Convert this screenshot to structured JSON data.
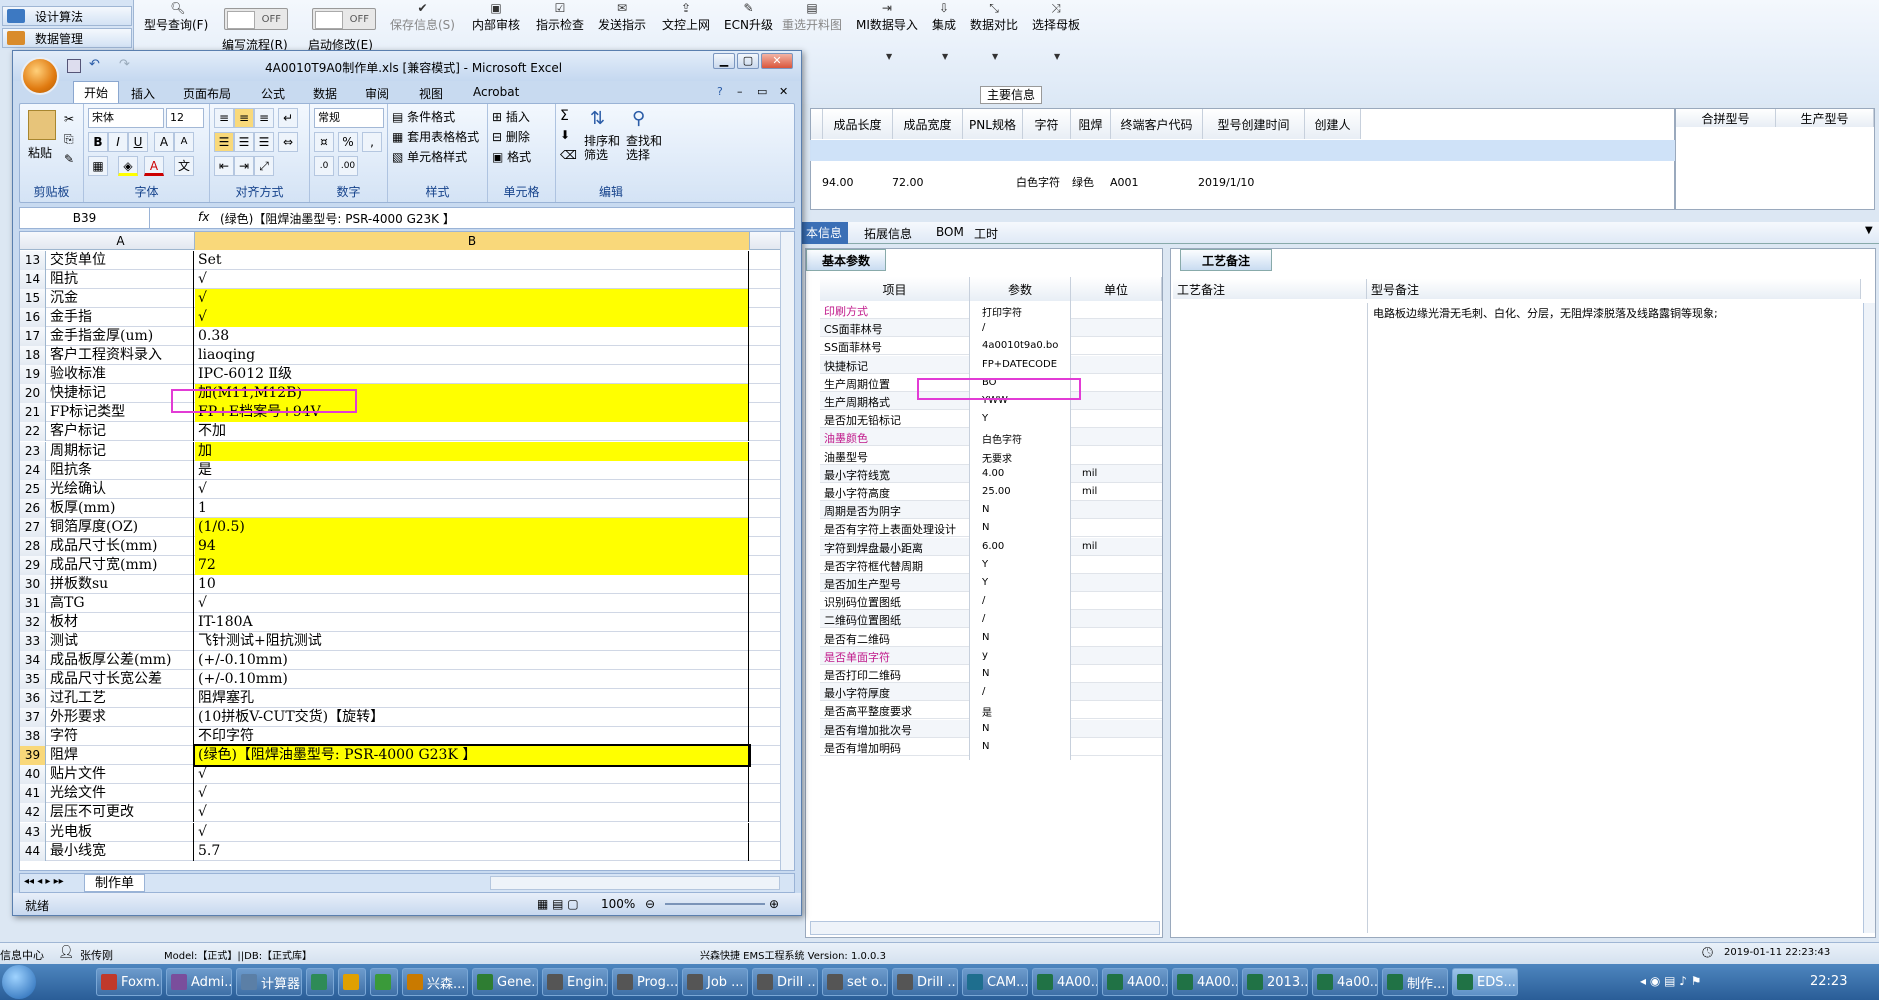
{
  "host": {
    "nav": [
      "设计算法",
      "数据管理"
    ],
    "toolbar": [
      {
        "label": "型号查询(F)",
        "icon": "search-icon"
      },
      {
        "label": "保存信息(S)",
        "icon": "check-icon"
      },
      {
        "label": "内部审核",
        "icon": "print-icon"
      },
      {
        "label": "指示检查",
        "icon": "checklist-icon"
      },
      {
        "label": "发送指示",
        "icon": "send-icon"
      },
      {
        "label": "文控上网",
        "icon": "upload-icon"
      },
      {
        "label": "ECN升级",
        "icon": "wrench-icon"
      },
      {
        "label": "重选开料图",
        "icon": "image-icon"
      },
      {
        "label": "MI数据导入",
        "icon": "import-icon"
      },
      {
        "label": "集成",
        "icon": "download-icon"
      },
      {
        "label": "数据对比",
        "icon": "compare-icon"
      },
      {
        "label": "选择母板",
        "icon": "shuffle-icon"
      }
    ],
    "toggle1": "OFF",
    "toggle2": "OFF",
    "sub1": "编写流程(R)",
    "sub2": "启动修改(E)",
    "main_header": "主要信息",
    "grid_headers": [
      "成品长度",
      "成品宽度",
      "PNL规格",
      "字符",
      "阻焊",
      "终端客户代码",
      "型号创建时间",
      "创建人"
    ],
    "grid_row": [
      "94.00",
      "72.00",
      "",
      "白色字符",
      "绿色",
      "A001",
      "2019/1/10",
      ""
    ],
    "right_headers": [
      "合拼型号",
      "生产型号"
    ],
    "lower_tabs": [
      "本信息",
      "拓展信息",
      "BOM",
      "工时"
    ],
    "bp_tab": "基本参数",
    "bp_headers": [
      "项目",
      "参数",
      "单位"
    ],
    "bp_rows": [
      {
        "k": "印刷方式",
        "v": "打印字符",
        "u": "",
        "pink": true
      },
      {
        "k": "CS面菲林号",
        "v": "/",
        "u": ""
      },
      {
        "k": "SS面菲林号",
        "v": "4a0010t9a0.bo",
        "u": ""
      },
      {
        "k": "快捷标记",
        "v": "FP+DATECODE",
        "u": ""
      },
      {
        "k": "生产周期位置",
        "v": "BO",
        "u": ""
      },
      {
        "k": "生产周期格式",
        "v": "YWW",
        "u": ""
      },
      {
        "k": "是否加无铅标记",
        "v": "Y",
        "u": ""
      },
      {
        "k": "油墨颜色",
        "v": "白色字符",
        "u": "",
        "pink": true
      },
      {
        "k": "油墨型号",
        "v": "无要求",
        "u": ""
      },
      {
        "k": "最小字符线宽",
        "v": "4.00",
        "u": "mil"
      },
      {
        "k": "最小字符高度",
        "v": "25.00",
        "u": "mil"
      },
      {
        "k": "周期是否为阴字",
        "v": "N",
        "u": ""
      },
      {
        "k": "是否有字符上表面处理设计",
        "v": "N",
        "u": ""
      },
      {
        "k": "字符到焊盘最小距离",
        "v": "6.00",
        "u": "mil"
      },
      {
        "k": "是否字符框代替周期",
        "v": "Y",
        "u": ""
      },
      {
        "k": "是否加生产型号",
        "v": "Y",
        "u": ""
      },
      {
        "k": "识别码位置图纸",
        "v": "/",
        "u": ""
      },
      {
        "k": "二维码位置图纸",
        "v": "/",
        "u": ""
      },
      {
        "k": "是否有二维码",
        "v": "N",
        "u": ""
      },
      {
        "k": "是否单面字符",
        "v": "y",
        "u": "",
        "pink": true
      },
      {
        "k": "是否打印二维码",
        "v": "N",
        "u": ""
      },
      {
        "k": "最小字符厚度",
        "v": "/",
        "u": ""
      },
      {
        "k": "是否高平整度要求",
        "v": "是",
        "u": ""
      },
      {
        "k": "是否有增加批次号",
        "v": "N",
        "u": ""
      },
      {
        "k": "是否有增加明码",
        "v": "N",
        "u": ""
      }
    ],
    "pn_tab": "工艺备注",
    "pn_headers": [
      "工艺备注",
      "型号备注"
    ],
    "pn_note": "电路板边缘光滑无毛刺、白化、分层，无阻焊漆脱落及线路露铜等现象;",
    "status_left": "信息中心",
    "status_user": "张传刚",
    "status_model": "Model:【正式】||DB:【正式库】",
    "status_version": "兴森快捷 EMS工程系统 Version: 1.0.0.3",
    "status_time": "2019-01-11 22:23:43"
  },
  "excel": {
    "title": "4A0010T9A0制作单.xls [兼容模式] - Microsoft Excel",
    "tabs": [
      "开始",
      "插入",
      "页面布局",
      "公式",
      "数据",
      "审阅",
      "视图",
      "Acrobat"
    ],
    "font_name": "宋体",
    "font_size": "12",
    "num_format": "常规",
    "groups": [
      "剪贴板",
      "字体",
      "对齐方式",
      "数字",
      "样式",
      "单元格",
      "编辑"
    ],
    "paste": "粘贴",
    "style_items": [
      "条件格式",
      "套用表格格式",
      "单元格样式"
    ],
    "cell_items": [
      "插入",
      "删除",
      "格式"
    ],
    "edit_items": [
      "排序和\n筛选",
      "查找和\n选择"
    ],
    "name_box": "B39",
    "formula": "(绿色)【阻焊油墨型号: PSR-4000 G23K 】",
    "col_a": "A",
    "col_b": "B",
    "rows": [
      {
        "n": "13",
        "a": "交货单位",
        "b": "Set",
        "y": false
      },
      {
        "n": "14",
        "a": "阻抗",
        "b": "√",
        "y": false
      },
      {
        "n": "15",
        "a": "沉金",
        "b": "√",
        "y": true
      },
      {
        "n": "16",
        "a": "金手指",
        "b": "√",
        "y": true
      },
      {
        "n": "17",
        "a": "金手指金厚(um)",
        "b": "0.38",
        "y": false
      },
      {
        "n": "18",
        "a": "客户工程资料录入",
        "b": "liaoqing",
        "y": false
      },
      {
        "n": "19",
        "a": "验收标准",
        "b": "IPC-6012 Ⅱ级",
        "y": false
      },
      {
        "n": "20",
        "a": "快捷标记",
        "b": "加(M11,M12B)",
        "y": true
      },
      {
        "n": "21",
        "a": "FP标记类型",
        "b": "FP+E档案号+94V",
        "y": true
      },
      {
        "n": "22",
        "a": "客户标记",
        "b": "不加",
        "y": false
      },
      {
        "n": "23",
        "a": "周期标记",
        "b": "加",
        "y": true
      },
      {
        "n": "24",
        "a": "阻抗条",
        "b": "是",
        "y": false
      },
      {
        "n": "25",
        "a": "光绘确认",
        "b": "√",
        "y": false
      },
      {
        "n": "26",
        "a": "板厚(mm)",
        "b": "1",
        "y": false
      },
      {
        "n": "27",
        "a": "铜箔厚度(OZ)",
        "b": "(1/0.5)",
        "y": true
      },
      {
        "n": "28",
        "a": "成品尺寸长(mm)",
        "b": "94",
        "y": true
      },
      {
        "n": "29",
        "a": "成品尺寸宽(mm)",
        "b": "72",
        "y": true
      },
      {
        "n": "30",
        "a": "拼板数su",
        "b": "10",
        "y": false
      },
      {
        "n": "31",
        "a": "高TG",
        "b": "√",
        "y": false
      },
      {
        "n": "32",
        "a": "板材",
        "b": "IT-180A",
        "y": false
      },
      {
        "n": "33",
        "a": "测试",
        "b": "飞针测试+阻抗测试",
        "y": false
      },
      {
        "n": "34",
        "a": "成品板厚公差(mm)",
        "b": "(+/-0.10mm)",
        "y": false
      },
      {
        "n": "35",
        "a": "成品尺寸长宽公差",
        "b": "(+/-0.10mm)",
        "y": false
      },
      {
        "n": "36",
        "a": "过孔工艺",
        "b": "阻焊塞孔",
        "y": false
      },
      {
        "n": "37",
        "a": "外形要求",
        "b": "(10拼板V-CUT交货)【旋转】",
        "y": false
      },
      {
        "n": "38",
        "a": "字符",
        "b": "不印字符",
        "y": false
      },
      {
        "n": "39",
        "a": "阻焊",
        "b": "(绿色)【阻焊油墨型号: PSR-4000 G23K 】",
        "y": true
      },
      {
        "n": "40",
        "a": "贴片文件",
        "b": "√",
        "y": false
      },
      {
        "n": "41",
        "a": "光绘文件",
        "b": "√",
        "y": false
      },
      {
        "n": "42",
        "a": "层压不可更改",
        "b": "√",
        "y": false
      },
      {
        "n": "43",
        "a": "光电板",
        "b": "√",
        "y": false
      },
      {
        "n": "44",
        "a": "最小线宽",
        "b": "5.7",
        "y": false
      }
    ],
    "sheet_tab": "制作单",
    "status": "就绪",
    "zoom": "100%"
  },
  "taskbar": [
    {
      "t": "Foxm...",
      "c": "#c0392b"
    },
    {
      "t": "Admi...",
      "c": "#7a4e9c"
    },
    {
      "t": "计算器",
      "c": "#5b7fa6"
    },
    {
      "t": "",
      "c": "#2e8b57"
    },
    {
      "t": "",
      "c": "#e0a000"
    },
    {
      "t": "",
      "c": "#3a9a3a"
    },
    {
      "t": "兴森...",
      "c": "#c97a00"
    },
    {
      "t": "Gene...",
      "c": "#2e7d32"
    },
    {
      "t": "Engin...",
      "c": "#555"
    },
    {
      "t": "Prog...",
      "c": "#555"
    },
    {
      "t": "Job ...",
      "c": "#555"
    },
    {
      "t": "Drill ...",
      "c": "#555"
    },
    {
      "t": "set o...",
      "c": "#555"
    },
    {
      "t": "Drill ...",
      "c": "#555"
    },
    {
      "t": "CAM...",
      "c": "#1e6e8e"
    },
    {
      "t": "4A00...",
      "c": "#207245"
    },
    {
      "t": "4A00...",
      "c": "#207245"
    },
    {
      "t": "4A00...",
      "c": "#207245"
    },
    {
      "t": "2013...",
      "c": "#207245"
    },
    {
      "t": "4a00...",
      "c": "#207245"
    },
    {
      "t": "制作...",
      "c": "#207245"
    },
    {
      "t": "EDS...",
      "c": "#207245"
    }
  ],
  "clock": "22:23"
}
